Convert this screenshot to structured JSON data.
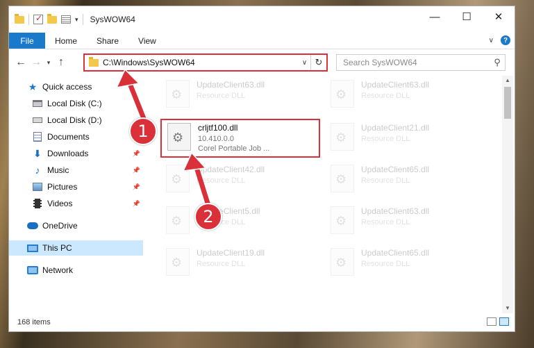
{
  "window": {
    "title": "SysWOW64"
  },
  "ribbon": {
    "tabs": [
      "File",
      "Home",
      "Share",
      "View"
    ]
  },
  "address": {
    "path": "C:\\Windows\\SysWOW64"
  },
  "search": {
    "placeholder": "Search SysWOW64"
  },
  "sidebar": {
    "items": [
      {
        "label": "Quick access",
        "icon": "star-icon"
      },
      {
        "label": "Local Disk (C:)",
        "icon": "drive-icon"
      },
      {
        "label": "Local Disk (D:)",
        "icon": "drive-icon"
      },
      {
        "label": "Documents",
        "icon": "documents-icon",
        "pinned": true
      },
      {
        "label": "Downloads",
        "icon": "download-icon",
        "pinned": true
      },
      {
        "label": "Music",
        "icon": "music-icon",
        "pinned": true
      },
      {
        "label": "Pictures",
        "icon": "pictures-icon",
        "pinned": true
      },
      {
        "label": "Videos",
        "icon": "videos-icon",
        "pinned": true
      },
      {
        "label": "OneDrive",
        "icon": "cloud-icon"
      },
      {
        "label": "This PC",
        "icon": "pc-icon",
        "selected": true
      },
      {
        "label": "Network",
        "icon": "network-icon"
      }
    ]
  },
  "files": {
    "col1": [
      {
        "name": "UpdateClient63.dll",
        "sub": "Resource DLL"
      },
      {
        "name": "crljtf100.dll",
        "version": "10.410.0.0",
        "sub": "Corel Portable Job ..."
      },
      {
        "name": "UpdateClient42.dll",
        "sub": "Resource DLL"
      },
      {
        "name": "UpdateClient5.dll",
        "sub": "Resource DLL"
      },
      {
        "name": "UpdateClient19.dll",
        "sub": "Resource DLL"
      }
    ],
    "col2": [
      {
        "name": "UpdateClient63.dll",
        "sub": "Resource DLL"
      },
      {
        "name": "UpdateClient21.dll",
        "sub": "Resource DLL"
      },
      {
        "name": "UpdateClient65.dll",
        "sub": "Resource DLL"
      },
      {
        "name": "UpdateClient63.dll",
        "sub": "Resource DLL"
      },
      {
        "name": "UpdateClient65.dll",
        "sub": "Resource DLL"
      }
    ]
  },
  "status": {
    "item_count": "168 items"
  },
  "annotations": {
    "step1": "1",
    "step2": "2",
    "color": "#d9303a"
  }
}
